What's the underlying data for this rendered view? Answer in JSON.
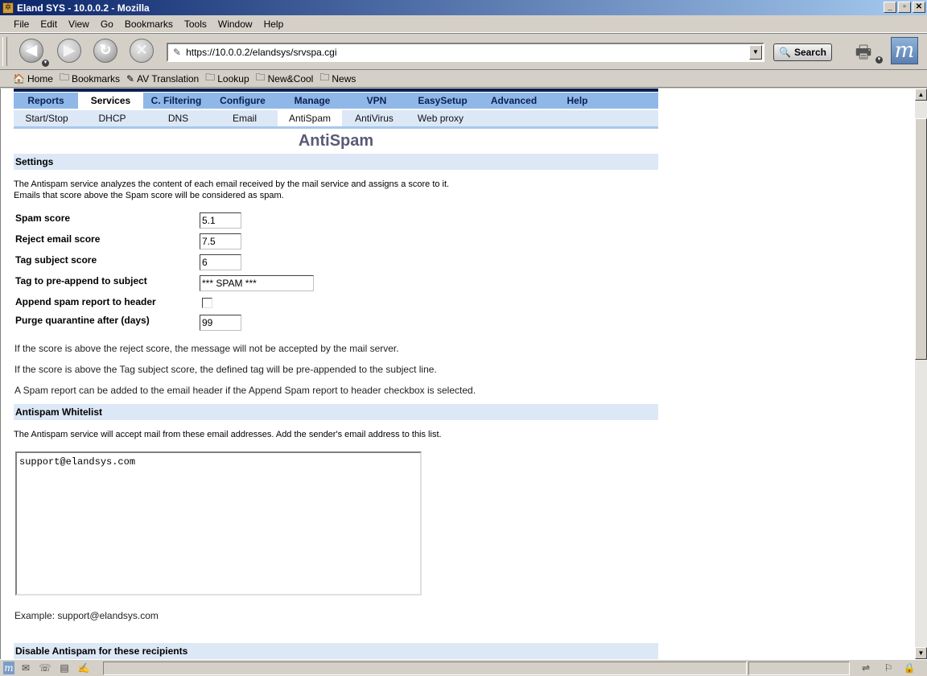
{
  "window": {
    "title": "Eland SYS - 10.0.0.2 - Mozilla",
    "controls": [
      "_",
      "▫",
      "✕"
    ]
  },
  "menu": [
    "File",
    "Edit",
    "View",
    "Go",
    "Bookmarks",
    "Tools",
    "Window",
    "Help"
  ],
  "toolbar": {
    "url": "https://10.0.0.2/elandsys/srvspa.cgi",
    "search_label": "Search"
  },
  "bookmarks": [
    {
      "label": "Home",
      "icon": "home-icon"
    },
    {
      "label": "Bookmarks",
      "icon": "folder-icon"
    },
    {
      "label": "AV Translation",
      "icon": "link-icon"
    },
    {
      "label": "Lookup",
      "icon": "folder-icon"
    },
    {
      "label": "New&Cool",
      "icon": "folder-icon"
    },
    {
      "label": "News",
      "icon": "folder-icon"
    }
  ],
  "nav": {
    "main_tabs": [
      "Reports",
      "Services",
      "C. Filtering",
      "Configure",
      "Manage",
      "VPN",
      "EasySetup",
      "Advanced",
      "Help"
    ],
    "main_active": "Services",
    "sub_tabs": [
      "Start/Stop",
      "DHCP",
      "DNS",
      "Email",
      "AntiSpam",
      "AntiVirus",
      "Web proxy"
    ],
    "sub_active": "AntiSpam"
  },
  "page": {
    "title": "AntiSpam",
    "settings_heading": "Settings",
    "settings_desc_1": "The Antispam service analyzes the content of each email received by the mail service and assigns a score to it.",
    "settings_desc_2": "Emails that score above the Spam score will be considered as spam.",
    "fields": {
      "spam_score": {
        "label": "Spam score",
        "value": "5.1"
      },
      "reject_score": {
        "label": "Reject email score",
        "value": "7.5"
      },
      "tag_score": {
        "label": "Tag subject score",
        "value": "6"
      },
      "tag_text": {
        "label": "Tag to pre-append to subject",
        "value": "*** SPAM ***"
      },
      "append_report": {
        "label": "Append spam report to header",
        "checked": false
      },
      "purge_days": {
        "label": "Purge quarantine after (days)",
        "value": "99"
      }
    },
    "note_1": "If the score is above the reject score, the message will not be accepted by the mail server.",
    "note_2": "If the score is above the Tag subject score, the defined tag will be pre-appended to the subject line.",
    "note_3": "A Spam report can be added to the email header if the Append Spam report to header checkbox is selected.",
    "whitelist_heading": "Antispam Whitelist",
    "whitelist_desc": "The Antispam service will accept mail from these email addresses. Add the sender's email address to this list.",
    "whitelist_value": "support@elandsys.com",
    "example": "Example: support@elandsys.com",
    "disable_heading": "Disable Antispam for these recipients"
  }
}
